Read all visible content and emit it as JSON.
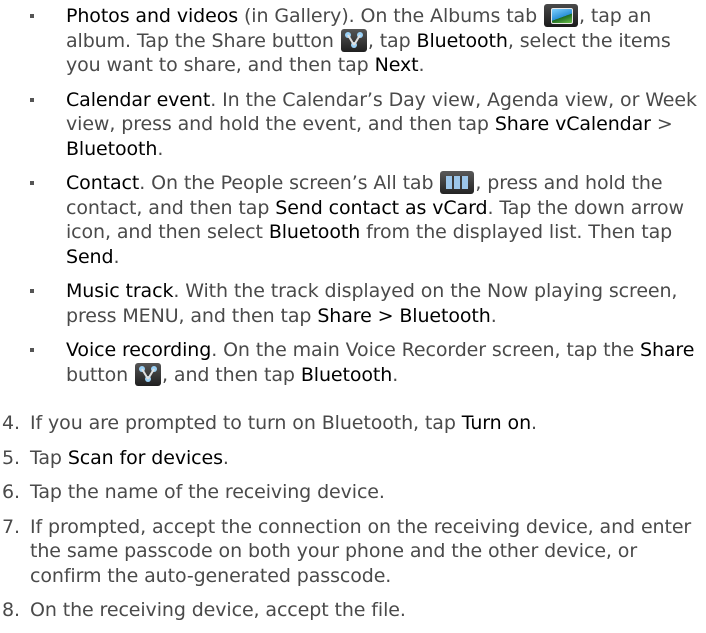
{
  "bullets": [
    {
      "head": "Photos and videos",
      "p1": " (in Gallery). On the Albums tab ",
      "p2": ", tap an album. Tap the Share button ",
      "p3": ", tap ",
      "b1": "Bluetooth",
      "p4": ", select the items you want to share, and then tap ",
      "b2": "Next",
      "p5": "."
    },
    {
      "head": "Calendar event",
      "p1": ". In the Calendar’s Day view, Agenda view, or Week view, press and hold the event, and then tap ",
      "b1": "Share vCalendar",
      "p2": " > ",
      "b2": "Bluetooth",
      "p3": "."
    },
    {
      "head": "Contact",
      "p1": ". On the People screen’s All tab ",
      "p2": ", press and hold the contact, and then tap ",
      "b1": "Send contact as vCard",
      "p3": ". Tap the down arrow icon, and then select ",
      "b2": "Bluetooth",
      "p4": " from the displayed list. Then tap ",
      "b3": "Send",
      "p5": "."
    },
    {
      "head": "Music track",
      "p1": ". With the track displayed on the Now playing screen, press MENU, and then tap ",
      "b1": "Share > Bluetooth",
      "p2": "."
    },
    {
      "head": "Voice recording",
      "p1": ". On the main Voice Recorder screen, tap the ",
      "b1": "Share",
      "p2": " button ",
      "p3": ", and then tap ",
      "b2": "Bluetooth",
      "p4": "."
    }
  ],
  "steps": [
    {
      "num": "4.",
      "p1": "If you are prompted to turn on Bluetooth, tap ",
      "b1": "Turn on",
      "p2": "."
    },
    {
      "num": "5.",
      "p1": "Tap ",
      "b1": "Scan for devices",
      "p2": "."
    },
    {
      "num": "6.",
      "p1": "Tap the name of the receiving device."
    },
    {
      "num": "7.",
      "p1": "If prompted, accept the connection on the receiving device, and enter the same passcode on both your phone and the other device, or confirm the auto-generated passcode."
    },
    {
      "num": "8.",
      "p1": "On the receiving device, accept the file."
    }
  ]
}
